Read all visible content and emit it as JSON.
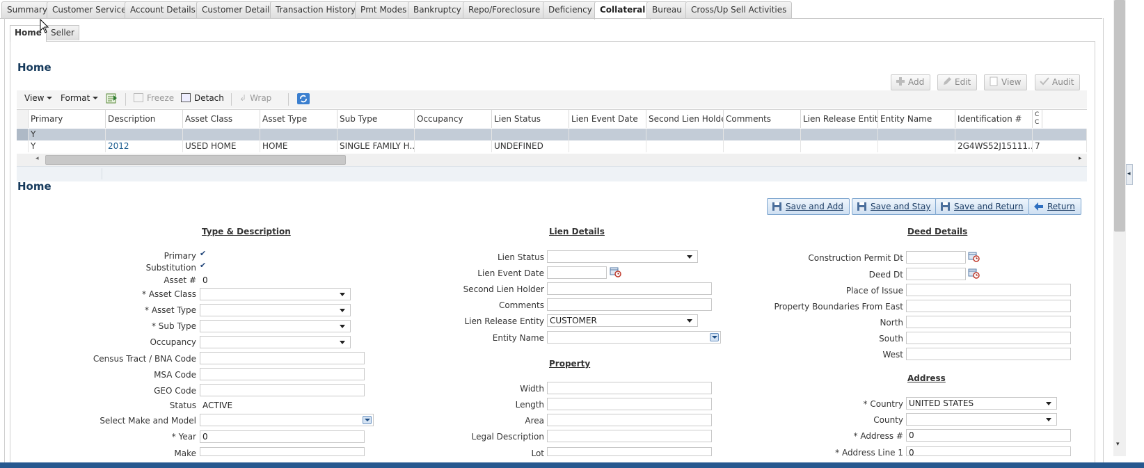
{
  "tabs": [
    {
      "label": "Summary"
    },
    {
      "label": "Customer Service"
    },
    {
      "label": "Account Details"
    },
    {
      "label": "Customer Details"
    },
    {
      "label": "Transaction History"
    },
    {
      "label": "Pmt Modes"
    },
    {
      "label": "Bankruptcy"
    },
    {
      "label": "Repo/Foreclosure"
    },
    {
      "label": "Deficiency"
    },
    {
      "label": "Collateral"
    },
    {
      "label": "Bureau"
    },
    {
      "label": "Cross/Up Sell Activities"
    }
  ],
  "active_tab": "Collateral",
  "subtabs": [
    {
      "label": "Home"
    },
    {
      "label": "Seller"
    }
  ],
  "home_title": "Home",
  "actions": {
    "add": "Add",
    "edit": "Edit",
    "view": "View",
    "audit": "Audit"
  },
  "toolbar": {
    "view": "View",
    "format": "Format",
    "freeze": "Freeze",
    "detach": "Detach",
    "wrap": "Wrap"
  },
  "grid": {
    "columns": [
      "Primary",
      "Description",
      "Asset Class",
      "Asset Type",
      "Sub Type",
      "Occupancy",
      "Lien Status",
      "Lien Event Date",
      "Second Lien Holder",
      "Comments",
      "Lien Release Entity",
      "Entity Name",
      "Identification #",
      "C C"
    ],
    "rows": [
      {
        "primary": "Y",
        "description": "",
        "asset_class": "",
        "asset_type": "",
        "sub_type": "",
        "occupancy": "",
        "lien_status": "",
        "identification": "",
        "c": ""
      },
      {
        "primary": "Y",
        "description": "2012",
        "asset_class": "USED HOME",
        "asset_type": "HOME",
        "sub_type": "SINGLE FAMILY H...",
        "occupancy": "",
        "lien_status": "UNDEFINED",
        "identification": "2G4WS52J15111...",
        "c": "7"
      }
    ]
  },
  "detail_title": "Home",
  "buttons": {
    "save_add": "Save and Add",
    "save_stay": "Save and Stay",
    "save_return": "Save and Return",
    "return": "Return"
  },
  "type_desc": {
    "heading": "Type & Description",
    "primary_label": "Primary",
    "primary_checked": true,
    "substitution_label": "Substitution",
    "substitution_checked": true,
    "asset_no_label": "Asset #",
    "asset_no": "0",
    "asset_class_label": "* Asset Class",
    "asset_class": "",
    "asset_type_label": "* Asset Type",
    "asset_type": "",
    "sub_type_label": "* Sub Type",
    "sub_type": "",
    "occupancy_label": "Occupancy",
    "occupancy": "",
    "census_label": "Census Tract / BNA Code",
    "census": "",
    "msa_label": "MSA Code",
    "msa": "",
    "geo_label": "GEO Code",
    "geo": "",
    "status_label": "Status",
    "status": "ACTIVE",
    "make_model_label": "Select Make and Model",
    "make_model": "",
    "year_label": "* Year",
    "year": "0",
    "make_label": "Make",
    "make": ""
  },
  "lien": {
    "heading": "Lien Details",
    "status_label": "Lien Status",
    "status": "",
    "event_date_label": "Lien Event Date",
    "event_date": "",
    "second_holder_label": "Second Lien Holder",
    "second_holder": "",
    "comments_label": "Comments",
    "comments": "",
    "release_entity_label": "Lien Release Entity",
    "release_entity": "CUSTOMER",
    "entity_name_label": "Entity Name",
    "entity_name": ""
  },
  "property": {
    "heading": "Property",
    "width_label": "Width",
    "width": "",
    "length_label": "Length",
    "length": "",
    "area_label": "Area",
    "area": "",
    "legal_label": "Legal Description",
    "legal": "",
    "lot_label": "Lot",
    "lot": ""
  },
  "deed": {
    "heading": "Deed Details",
    "construction_label": "Construction Permit Dt",
    "construction": "",
    "deed_dt_label": "Deed Dt",
    "deed_dt": "",
    "place_label": "Place of Issue",
    "place": "",
    "east_label": "Property Boundaries From East",
    "east": "",
    "north_label": "North",
    "north": "",
    "south_label": "South",
    "south": "",
    "west_label": "West",
    "west": ""
  },
  "address": {
    "heading": "Address",
    "country_label": "* Country",
    "country": "UNITED STATES",
    "county_label": "County",
    "county": "",
    "address_no_label": "* Address #",
    "address_no": "0",
    "line1_label": "* Address Line 1",
    "line1": "0"
  }
}
